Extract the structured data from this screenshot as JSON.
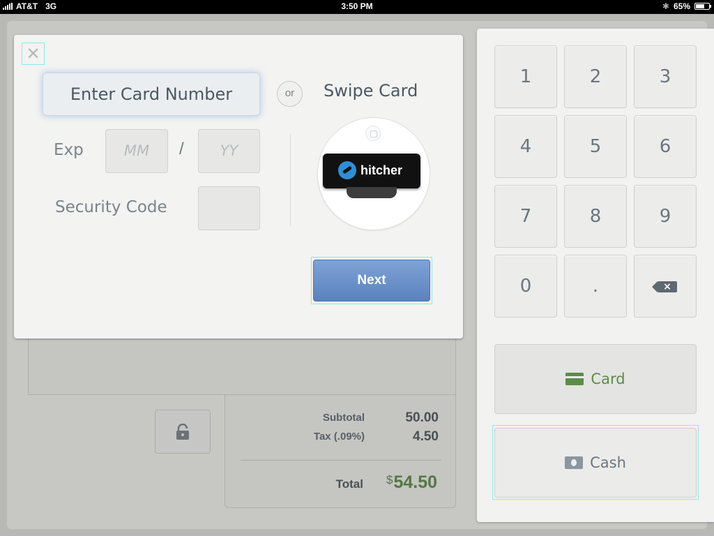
{
  "status_bar": {
    "carrier": "AT&T",
    "network": "3G",
    "time": "3:50 PM",
    "battery": "65%",
    "battery_level": 0.65
  },
  "payment_modal": {
    "close_label": "✕",
    "card_number_placeholder": "Enter Card Number",
    "or_label": "or",
    "swipe_title": "Swipe Card",
    "exp_label": "Exp",
    "month_placeholder": "MM",
    "slash": "/",
    "year_placeholder": "YY",
    "security_code_label": "Security Code",
    "reader_brand": "hitcher",
    "next_label": "Next"
  },
  "keypad": {
    "keys": [
      "1",
      "2",
      "3",
      "4",
      "5",
      "6",
      "7",
      "8",
      "9",
      "0",
      "."
    ],
    "backspace_icon": "backspace-icon"
  },
  "payment_buttons": {
    "card_label": "Card",
    "cash_label": "Cash",
    "card_color": "#5c8c4a"
  },
  "totals": {
    "subtotal_label": "Subtotal",
    "subtotal_value": "50.00",
    "tax_label": "Tax (.09%)",
    "tax_value": "4.50",
    "total_label": "Total",
    "total_currency": "$",
    "total_value": "54.50",
    "total_color": "#4a7a38"
  },
  "colors": {
    "accent_blue": "#6a90c9",
    "focus_outline": "#8fe6ee"
  }
}
